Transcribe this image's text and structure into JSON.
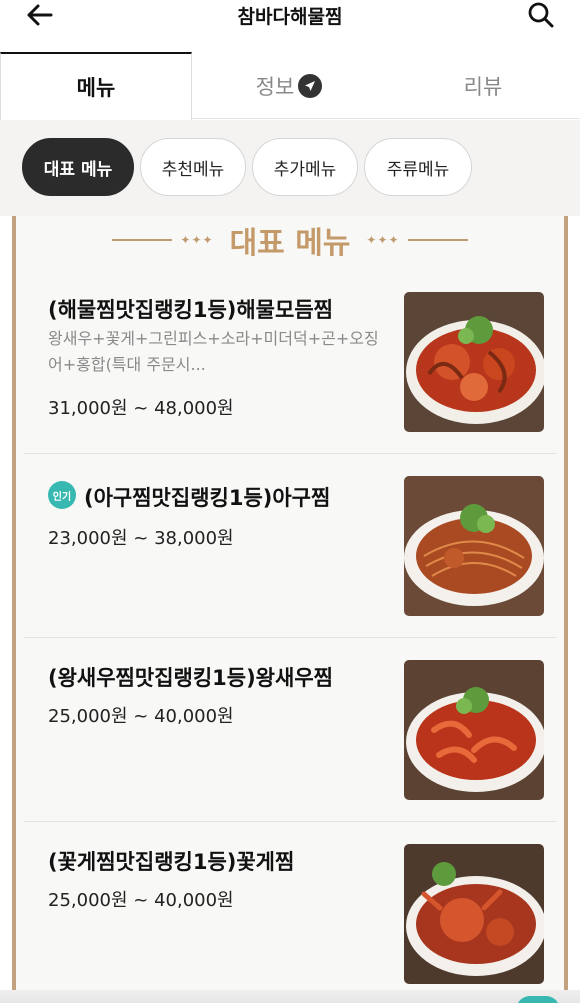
{
  "header": {
    "title": "참바다해물찜"
  },
  "tabs": [
    {
      "label": "메뉴",
      "active": true
    },
    {
      "label": "정보"
    },
    {
      "label": "리뷰"
    }
  ],
  "chips": [
    {
      "label": "대표 메뉴",
      "active": true
    },
    {
      "label": "추천메뉴"
    },
    {
      "label": "추가메뉴"
    },
    {
      "label": "주류메뉴"
    }
  ],
  "section": {
    "title": "대표 메뉴",
    "decoration": "✦✦✦"
  },
  "items": [
    {
      "name": "(해물찜맛집랭킹1등)해물모듬찜",
      "desc": "왕새우+꽃게+그린피스+소라+미더덕+곤+오징어+홍합(특대 주문시...",
      "price": "31,000원 ~ 48,000원"
    },
    {
      "badge": "인기",
      "name": "(아구찜맛집랭킹1등)아구찜",
      "price": "23,000원 ~ 38,000원"
    },
    {
      "name": "(왕새우찜맛집랭킹1등)왕새우찜",
      "price": "25,000원 ~ 40,000원"
    },
    {
      "name": "(꽃게찜맛집랭킹1등)꽃게찜",
      "price": "25,000원 ~ 40,000원"
    }
  ],
  "colors": {
    "accent_gold": "#c59a6a",
    "badge_teal": "#37b8b0",
    "chip_active": "#2b2b2b"
  }
}
